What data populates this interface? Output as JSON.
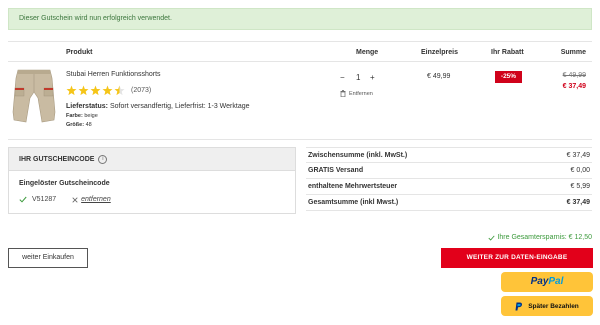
{
  "alert": {
    "message": "Dieser Gutschein wird nun erfolgreich verwendet."
  },
  "table": {
    "headers": {
      "product": "Produkt",
      "quantity": "Menge",
      "unit_price": "Einzelpreis",
      "discount": "Ihr Rabatt",
      "sum": "Summe"
    }
  },
  "item": {
    "name": "Stubai Herren Funktionsshorts",
    "rating": 4.5,
    "rating_count": "(2073)",
    "delivery_label": "Lieferstatus:",
    "delivery_value": "Sofort versandfertig, Lieferfrist: 1-3 Werktage",
    "color_label": "Farbe:",
    "color_value": "beige",
    "size_label": "Größe:",
    "size_value": "48",
    "qty_minus": "−",
    "qty_value": "1",
    "qty_plus": "+",
    "remove_label": "Entfernen",
    "unit_price": "€ 49,99",
    "discount_badge": "-25%",
    "old_total": "€ 49,99",
    "new_total": "€ 37,49"
  },
  "coupon": {
    "header": "IHR GUTSCHEINCODE",
    "info_icon": "i",
    "redeemed_title": "Eingelöster Gutscheincode",
    "code": "V51287",
    "remove_link": "entfernen"
  },
  "summary": {
    "rows": [
      {
        "label": "Zwischensumme (inkl. MwSt.)",
        "value": "€ 37,49"
      },
      {
        "label": "GRATIS Versand",
        "value": "€ 0,00"
      },
      {
        "label": "enthaltene Mehrwertsteuer",
        "value": "€ 5,99"
      },
      {
        "label": "Gesamtsumme (inkl Mwst.)",
        "value": "€ 37,49"
      }
    ]
  },
  "savings": {
    "text": "Ihre Gesamtersparnis: € 12,50"
  },
  "buttons": {
    "continue": "weiter Einkaufen",
    "checkout": "WEITER ZUR DATEN-EINGABE",
    "paypal_part1": "Pay",
    "paypal_part2": "Pal",
    "paylater": "Später Bezahlen"
  },
  "colors": {
    "accent_red": "#e2001a",
    "success_green": "#3c9a3c",
    "alert_bg": "#dff0d8",
    "paypal_yellow": "#ffc439",
    "star_yellow": "#f5c518"
  },
  "icons": {
    "stars": "star-icon",
    "info": "info-icon",
    "trash": "trash-icon",
    "check": "check-icon",
    "close": "close-icon",
    "paypal_p": "paypal-p-icon"
  }
}
